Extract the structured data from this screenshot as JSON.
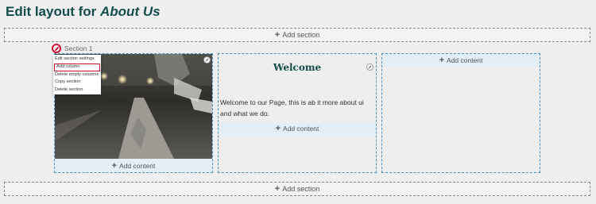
{
  "header": {
    "title_prefix": "Edit layout for",
    "title_page": "About Us"
  },
  "add_section_label": "Add section",
  "section": {
    "label": "Section 1",
    "menu": [
      "Edit section settings",
      "Add column",
      "Delete empty columns",
      "Copy section",
      "Delete section"
    ],
    "highlighted_menu_item": "Add column"
  },
  "columns": [
    {
      "add_content_label": "Add content",
      "image": "street-photo"
    },
    {
      "heading": "Welcome",
      "text": "Welcome to our Page, this is ab it more about ui and what we do.",
      "add_content_label": "Add content"
    },
    {
      "add_content_label": "Add content"
    }
  ],
  "colors": {
    "title": "#124d4a",
    "accent_red": "#c8102e",
    "column_border": "#4a90c6"
  },
  "icons": [
    "plus-icon",
    "pencil-icon"
  ]
}
